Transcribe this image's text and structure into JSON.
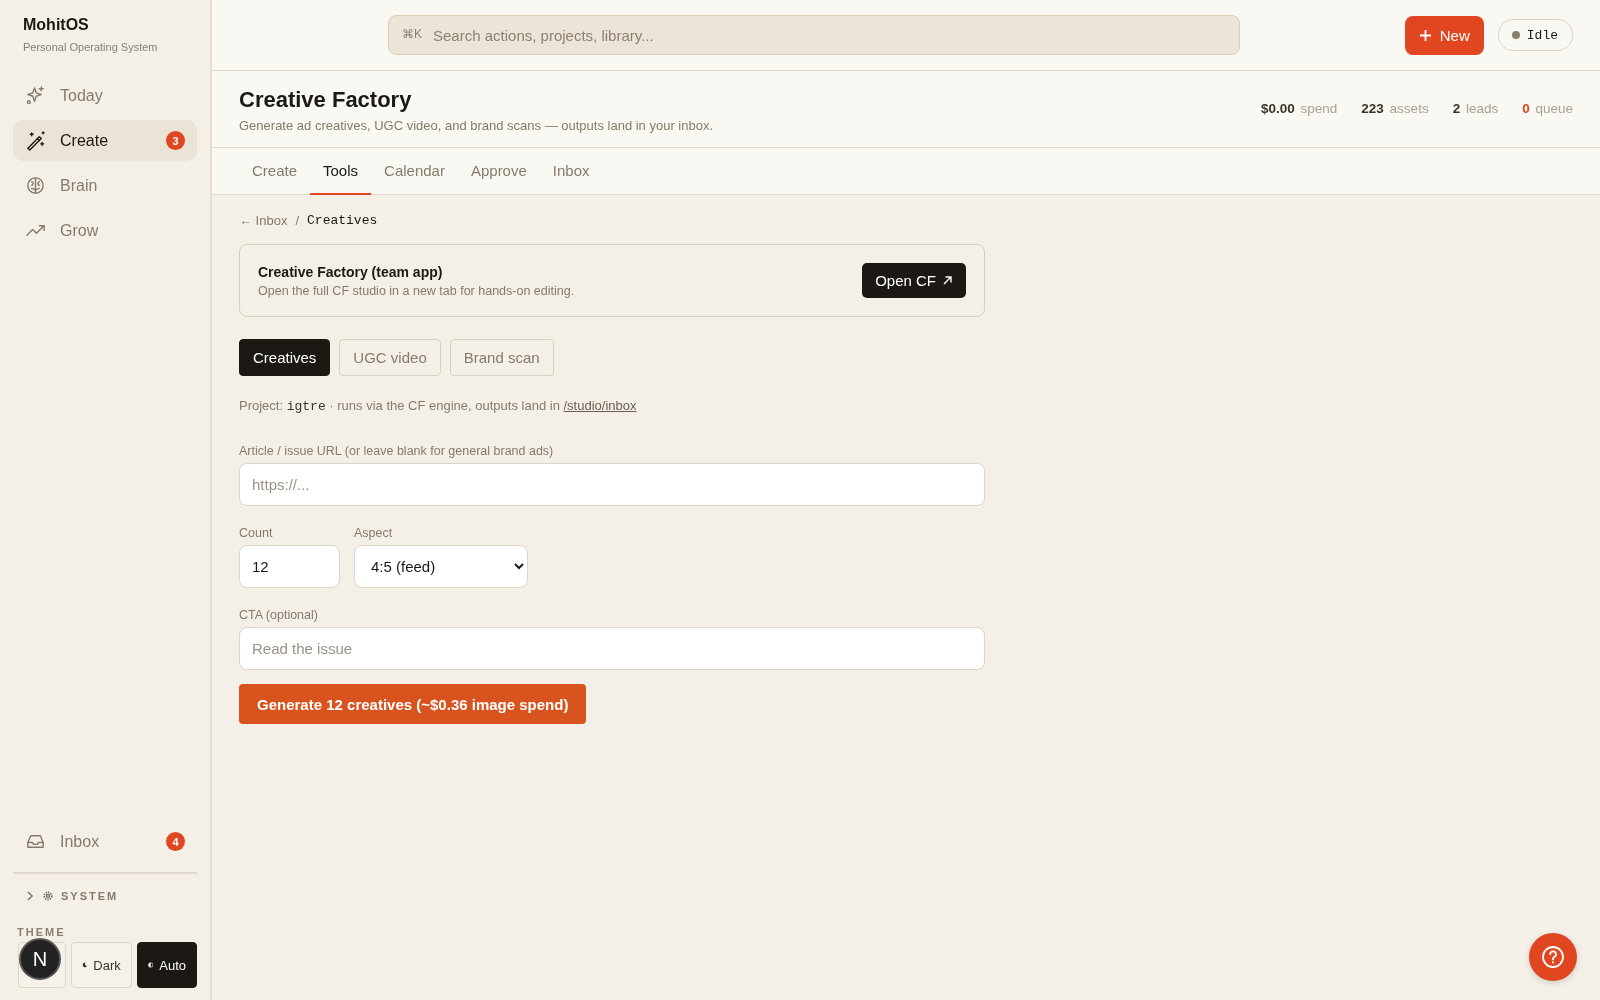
{
  "sidebar": {
    "brand": "MohitOS",
    "tagline": "Personal Operating System",
    "items": [
      {
        "label": "Today",
        "selected": false
      },
      {
        "label": "Create",
        "selected": true,
        "badge": "3"
      },
      {
        "label": "Brain",
        "selected": false
      },
      {
        "label": "Grow",
        "selected": false
      }
    ],
    "inbox": {
      "label": "Inbox",
      "badge": "4"
    },
    "system": {
      "label": "SYSTEM",
      "expanded": false
    },
    "theme": {
      "label": "THEME",
      "options": [
        {
          "selected": false
        },
        {
          "label": "Dark",
          "selected": false
        },
        {
          "label": "Auto",
          "selected": true
        }
      ]
    },
    "dev_badge": "N"
  },
  "topbar": {
    "search": {
      "shortcut": "⌘K",
      "placeholder": "Search actions, projects, library..."
    },
    "new_button": "New",
    "status": "Idle"
  },
  "header": {
    "title": "Creative Factory",
    "subtitle": "Generate ad creatives, UGC video, and brand scans — outputs land in your inbox.",
    "stats": [
      {
        "text": "**$0.00** spend",
        "kind": "normal"
      },
      {
        "text": "**223** assets",
        "kind": "normal"
      },
      {
        "text": "**2** leads",
        "kind": "normal"
      },
      {
        "text": "**0** queue",
        "kind": "alert"
      }
    ]
  },
  "tabs": [
    {
      "label": "Create",
      "selected": false
    },
    {
      "label": "Tools",
      "selected": true
    },
    {
      "label": "Calendar",
      "selected": false
    },
    {
      "label": "Approve",
      "selected": false
    },
    {
      "label": "Inbox",
      "selected": false
    }
  ],
  "breadcrumb": {
    "back": "← Inbox",
    "separator": "/",
    "current": "Creatives"
  },
  "app_card": {
    "title": "Creative Factory (team app)",
    "description": "Open the full CF studio in a new tab for hands-on editing.",
    "button": "Open CF"
  },
  "modes": [
    {
      "label": "Creatives",
      "selected": true
    },
    {
      "label": "UGC video",
      "selected": false
    },
    {
      "label": "Brand scan",
      "selected": false
    }
  ],
  "project_note": {
    "prefix": "Project:",
    "code": "igtre",
    "text": "· runs via the CF engine, outputs land in",
    "link": "/studio/inbox"
  },
  "form": {
    "url": {
      "label": "Article / issue URL (or leave blank for general brand ads)",
      "placeholder": "https://..."
    },
    "count": {
      "label": "Count",
      "value": "12"
    },
    "aspect": {
      "label": "Aspect",
      "value": "4:5 (feed)"
    },
    "cta": {
      "label": "CTA (optional)",
      "placeholder": "Read the issue"
    },
    "submit": "Generate 12 creatives (~$0.36 image spend)"
  }
}
